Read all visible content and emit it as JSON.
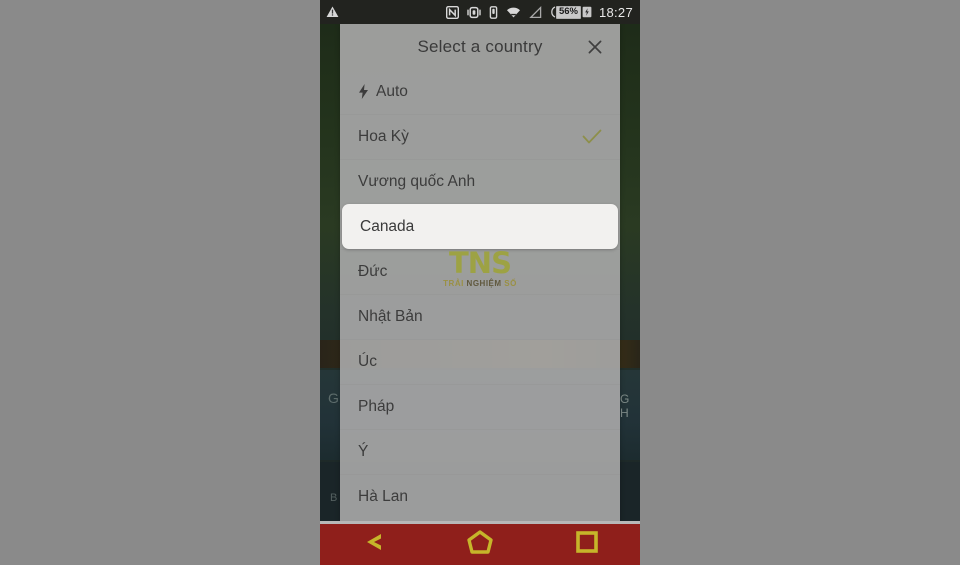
{
  "outer": {
    "background_color": "#8a8a8a"
  },
  "statusbar": {
    "time": "18:27",
    "battery_percent": "56%",
    "icons": [
      {
        "name": "warning-triangle-icon"
      },
      {
        "name": "nfc-icon"
      },
      {
        "name": "vibrate-icon"
      },
      {
        "name": "sim-icon"
      },
      {
        "name": "wifi-icon"
      },
      {
        "name": "signal-triangle-icon"
      },
      {
        "name": "battery-icon"
      }
    ],
    "background_color": "#22231f",
    "text_color": "#dcdcdc"
  },
  "dialog": {
    "title": "Select a country",
    "close_label": "✕",
    "background_color": "#a6a6a6",
    "selected_row_color": "#f2f1ef",
    "check_color": "#8d8f4a",
    "items": [
      {
        "label": "Auto",
        "icon": "bolt-icon",
        "checked": false,
        "selected": false
      },
      {
        "label": "Hoa Kỳ",
        "icon": "",
        "checked": true,
        "selected": false
      },
      {
        "label": "Vương quốc Anh",
        "icon": "",
        "checked": false,
        "selected": false
      },
      {
        "label": "Canada",
        "icon": "",
        "checked": false,
        "selected": true
      },
      {
        "label": "Đức",
        "icon": "",
        "checked": false,
        "selected": false
      },
      {
        "label": "Nhật Bản",
        "icon": "",
        "checked": false,
        "selected": false
      },
      {
        "label": "Úc",
        "icon": "",
        "checked": false,
        "selected": false
      },
      {
        "label": "Pháp",
        "icon": "",
        "checked": false,
        "selected": false
      },
      {
        "label": "Ý",
        "icon": "",
        "checked": false,
        "selected": false
      },
      {
        "label": "Hà Lan",
        "icon": "",
        "checked": false,
        "selected": false
      }
    ]
  },
  "watermark": {
    "main": "TNS",
    "sub_left": "TRẢI ",
    "sub_mid": "NGHIỆM",
    "sub_right": " SỐ",
    "color": "#9ea33d"
  },
  "background_app": {
    "label_g": "G",
    "label_gh": "G H",
    "label_b": "B"
  },
  "navbar": {
    "background_color": "#8f1f1b",
    "icon_color": "#c6b52a",
    "buttons": [
      {
        "name": "back-button",
        "icon": "back-chevron-icon"
      },
      {
        "name": "home-button",
        "icon": "home-pentagon-icon"
      },
      {
        "name": "recents-button",
        "icon": "recents-square-icon"
      }
    ]
  }
}
